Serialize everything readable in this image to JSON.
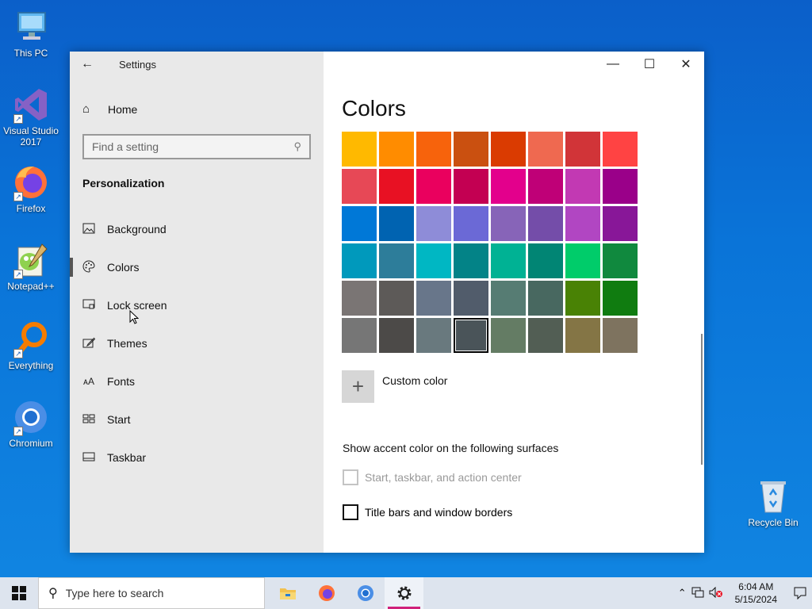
{
  "desktop": {
    "icons": [
      {
        "label": "This PC"
      },
      {
        "label": "Visual Studio 2017"
      },
      {
        "label": "Firefox"
      },
      {
        "label": "Notepad++"
      },
      {
        "label": "Everything"
      },
      {
        "label": "Chromium"
      },
      {
        "label": "Recycle Bin"
      }
    ]
  },
  "window": {
    "title": "Settings",
    "controls": {
      "minimize": "—",
      "maximize": "☐",
      "close": "✕"
    }
  },
  "sidebar": {
    "home_label": "Home",
    "search_placeholder": "Find a setting",
    "section": "Personalization",
    "items": [
      {
        "label": "Background",
        "icon": "picture-icon"
      },
      {
        "label": "Colors",
        "icon": "palette-icon",
        "active": true
      },
      {
        "label": "Lock screen",
        "icon": "lock-screen-icon"
      },
      {
        "label": "Themes",
        "icon": "themes-brush-icon"
      },
      {
        "label": "Fonts",
        "icon": "fonts-icon"
      },
      {
        "label": "Start",
        "icon": "start-layout-icon"
      },
      {
        "label": "Taskbar",
        "icon": "taskbar-icon"
      }
    ]
  },
  "content": {
    "title": "Colors",
    "swatches": [
      "#ffb900",
      "#ff8c00",
      "#f7630c",
      "#ca5010",
      "#da3b01",
      "#ef6950",
      "#d13438",
      "#ff4343",
      "#e74856",
      "#e81123",
      "#ea005e",
      "#c30052",
      "#e3008c",
      "#bf0077",
      "#c239b3",
      "#9a0089",
      "#0078d7",
      "#0063b1",
      "#8e8cd8",
      "#6b69d6",
      "#8764b8",
      "#744da9",
      "#b146c2",
      "#881798",
      "#0099bc",
      "#2d7d9a",
      "#00b7c3",
      "#038387",
      "#00b294",
      "#018574",
      "#00cc6a",
      "#10893e",
      "#7a7574",
      "#5d5a58",
      "#68768a",
      "#515c6b",
      "#567c73",
      "#486860",
      "#498205",
      "#107c10",
      "#767676",
      "#4c4a48",
      "#69797e",
      "#4a5459",
      "#647c64",
      "#525e54",
      "#847545",
      "#7e735f"
    ],
    "selected_swatch_index": 43,
    "custom_color_label": "Custom color",
    "surfaces_heading": "Show accent color on the following surfaces",
    "checkboxes": [
      {
        "label": "Start, taskbar, and action center",
        "checked": false,
        "disabled": true
      },
      {
        "label": "Title bars and window borders",
        "checked": false,
        "disabled": false
      }
    ]
  },
  "taskbar": {
    "search_placeholder": "Type here to search",
    "time": "6:04 AM",
    "date": "5/15/2024"
  }
}
